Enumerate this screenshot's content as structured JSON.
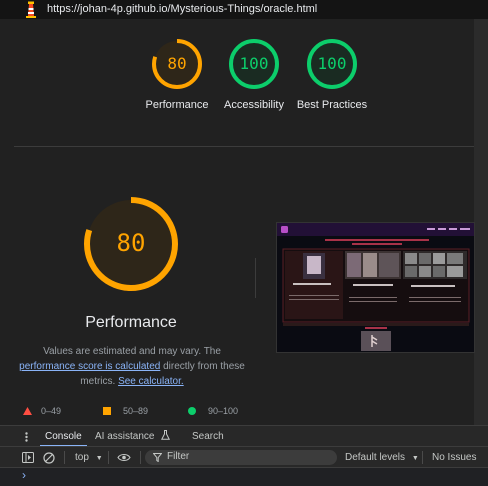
{
  "url_bar": {
    "url": "https://johan-4p.github.io/Mysterious-Things/oracle.html"
  },
  "summary_gauges": [
    {
      "score": "80",
      "label": "Performance",
      "color": "#ffa400"
    },
    {
      "score": "100",
      "label": "Accessibility",
      "color": "#0cce6b"
    },
    {
      "score": "100",
      "label": "Best Practices",
      "color": "#0cce6b"
    }
  ],
  "main": {
    "score": "80",
    "score_fraction": 0.8,
    "title": "Performance",
    "desc_1": "Values are estimated and may vary. The",
    "desc_link": "performance score is calculated",
    "desc_2": "directly from these metrics.",
    "desc_calc_link": "See calculator."
  },
  "legend": [
    {
      "range": "0–49",
      "color": "#ff4e42",
      "shape": "triangle"
    },
    {
      "range": "50–89",
      "color": "#ffa400",
      "shape": "square"
    },
    {
      "range": "90–100",
      "color": "#0cce6b",
      "shape": "circle"
    }
  ],
  "colors": {
    "average": "#ffa400",
    "pass": "#0cce6b",
    "fail": "#ff4e42",
    "link": "#8ab4f8"
  },
  "devtools": {
    "tabs": {
      "console": "Console",
      "ai": "AI assistance",
      "search": "Search"
    },
    "toolbar": {
      "context": "top",
      "filter_placeholder": "Filter",
      "levels": "Default levels",
      "issues": "No Issues"
    },
    "prompt": "›"
  }
}
